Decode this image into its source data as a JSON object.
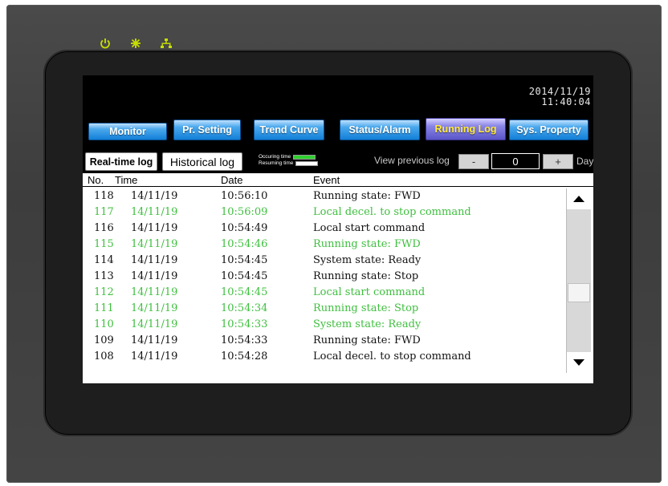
{
  "screen": {
    "date": "2014/11/19",
    "time": "11:40:04"
  },
  "tabs": [
    {
      "label": "Monitor"
    },
    {
      "label": "Pr. Setting"
    },
    {
      "label": "Trend Curve"
    },
    {
      "label": "Status/Alarm"
    },
    {
      "label": "Running Log"
    },
    {
      "label": "Sys. Property"
    }
  ],
  "toolbar": {
    "realtime_label": "Real-time log",
    "historical_label": "Historical log",
    "legend_occurring": "Occuring time",
    "legend_resuming": "Resuming time",
    "view_previous_label": "View previous log",
    "minus_label": "-",
    "day_count": "0",
    "plus_label": "+",
    "day_label": "Day"
  },
  "table": {
    "headers": {
      "no": "No.",
      "time": "Time",
      "date": "Date",
      "event": "Event"
    },
    "rows": [
      {
        "no": "118",
        "time": "14/11/19",
        "date": "10:56:10",
        "event": "Running state: FWD",
        "kind": "occurring"
      },
      {
        "no": "117",
        "time": "14/11/19",
        "date": "10:56:09",
        "event": "Local decel. to stop command",
        "kind": "resuming"
      },
      {
        "no": "116",
        "time": "14/11/19",
        "date": "10:54:49",
        "event": "Local start command",
        "kind": "occurring"
      },
      {
        "no": "115",
        "time": "14/11/19",
        "date": "10:54:46",
        "event": "Running state: FWD",
        "kind": "resuming"
      },
      {
        "no": "114",
        "time": "14/11/19",
        "date": "10:54:45",
        "event": "System state: Ready",
        "kind": "occurring"
      },
      {
        "no": "113",
        "time": "14/11/19",
        "date": "10:54:45",
        "event": "Running state: Stop",
        "kind": "occurring"
      },
      {
        "no": "112",
        "time": "14/11/19",
        "date": "10:54:45",
        "event": "Local start command",
        "kind": "resuming"
      },
      {
        "no": "111",
        "time": "14/11/19",
        "date": "10:54:34",
        "event": "Running state: Stop",
        "kind": "resuming"
      },
      {
        "no": "110",
        "time": "14/11/19",
        "date": "10:54:33",
        "event": "System state: Ready",
        "kind": "resuming"
      },
      {
        "no": "109",
        "time": "14/11/19",
        "date": "10:54:33",
        "event": "Running state: FWD",
        "kind": "occurring"
      },
      {
        "no": "108",
        "time": "14/11/19",
        "date": "10:54:28",
        "event": "Local decel. to stop command",
        "kind": "occurring"
      }
    ]
  },
  "colors": {
    "occurring": "#111111",
    "resuming": "#3fbf3f",
    "indicator": "#c8e000",
    "active_tab_text": "#ffeb3b"
  },
  "icons": [
    "power-icon",
    "activity-icon",
    "network-icon",
    "scroll-up-icon",
    "scroll-down-icon"
  ]
}
